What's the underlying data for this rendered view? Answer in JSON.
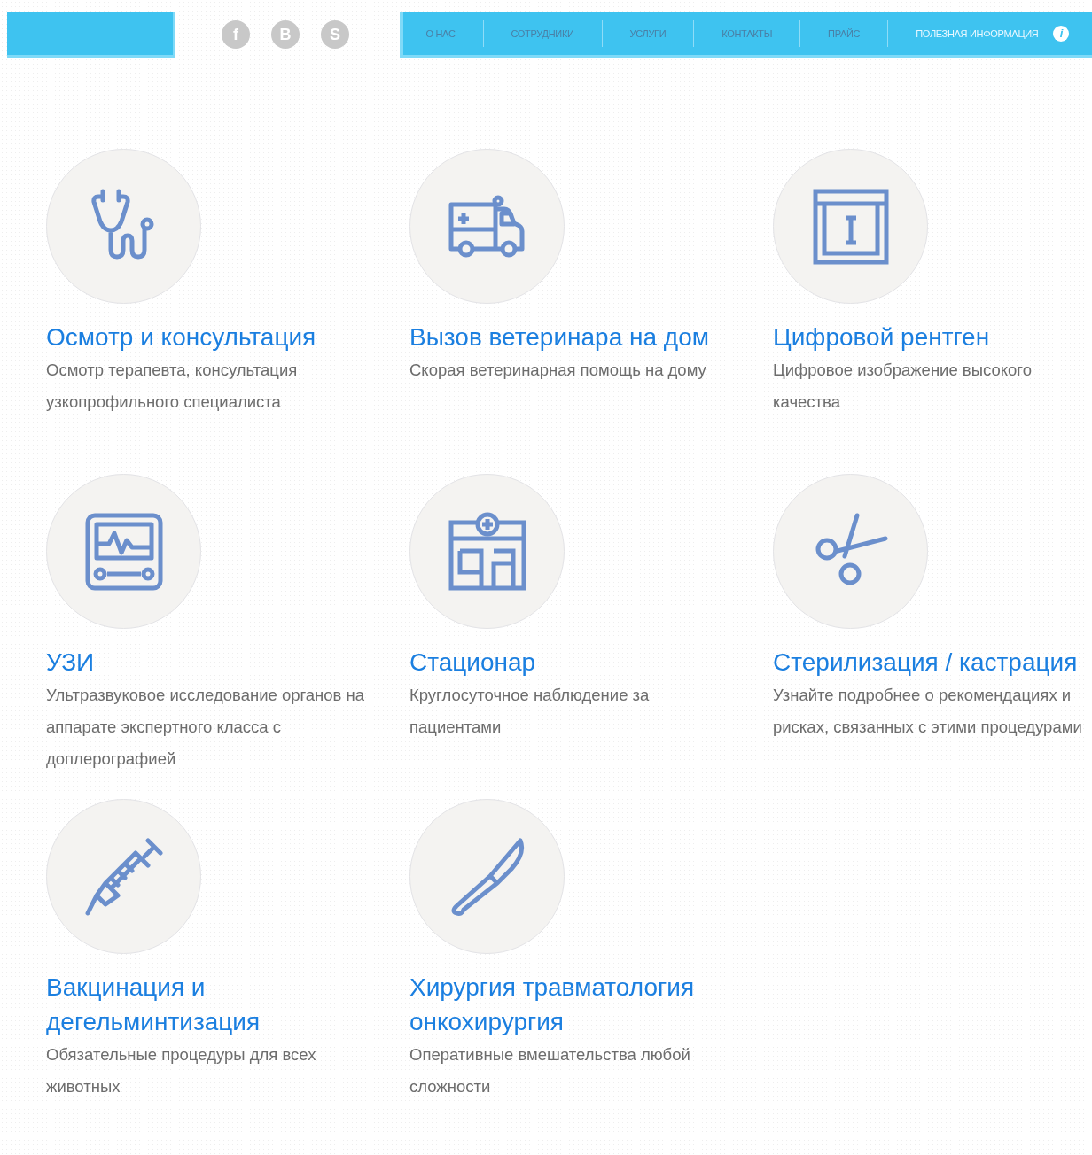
{
  "header": {
    "social": [
      {
        "glyph": "f"
      },
      {
        "glyph": "В"
      },
      {
        "glyph": "S"
      }
    ],
    "nav": [
      {
        "label": "О НАС",
        "highlight": false
      },
      {
        "label": "СОТРУДНИКИ",
        "highlight": false
      },
      {
        "label": "УСЛУГИ",
        "highlight": false
      },
      {
        "label": "КОНТАКТЫ",
        "highlight": false
      },
      {
        "label": "ПРАЙС",
        "highlight": false
      },
      {
        "label": "ПОЛЕЗНАЯ ИНФОРМАЦИЯ",
        "highlight": true,
        "badge": "i"
      }
    ]
  },
  "services": [
    {
      "kind": "stethoscope",
      "title": "Осмотр и консультация",
      "text": "Осмотр терапевта, консультация узкопрофильного специалиста"
    },
    {
      "kind": "ambulance",
      "title": "Вызов ветеринара на дом",
      "text": "Скорая ветеринарная помощь на дому"
    },
    {
      "kind": "xray",
      "title": "Цифровой рентген",
      "text": "Цифровое изображение высокого качества"
    },
    {
      "kind": "monitor",
      "title": "УЗИ",
      "text": "Ультразвуковое исследование органов на аппарате экспертного класса с доплерографией"
    },
    {
      "kind": "hospital",
      "title": "Стационар",
      "text": "Круглосуточное наблюдение за пациентами"
    },
    {
      "kind": "scissors",
      "title": "Стерилизация / кастрация",
      "text": "Узнайте подробнее о рекомендациях и рисках, связанных с этими процедурами"
    },
    {
      "kind": "syringe",
      "title": "Вакцинация и дегельминтизация",
      "text": "Обязательные процедуры для всех животных"
    },
    {
      "kind": "scalpel",
      "title": "Хирургия травматология онкохирургия",
      "text": "Оперативные вмешательства любой сложности"
    }
  ]
}
